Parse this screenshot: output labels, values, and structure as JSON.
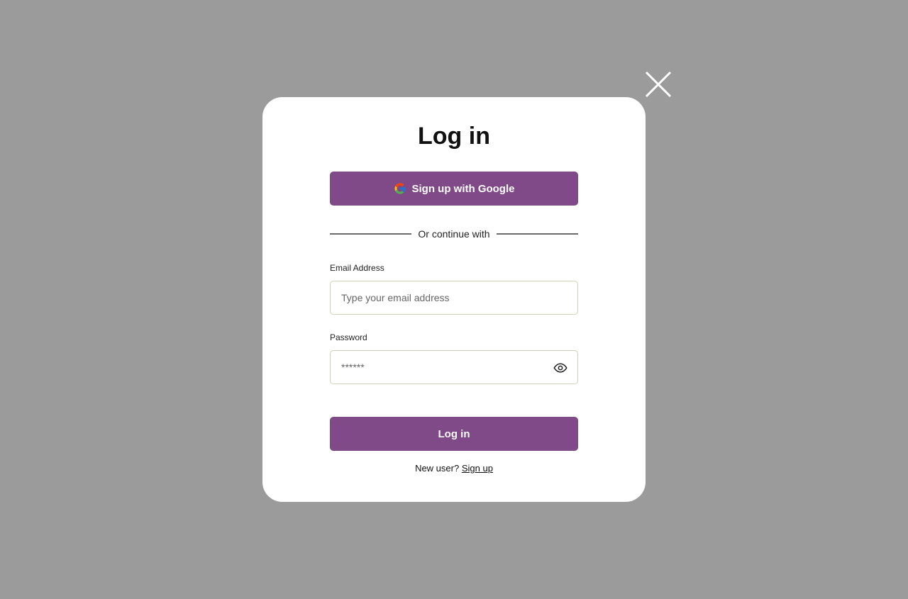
{
  "modal": {
    "title": "Log in",
    "google_button_label": "Sign up with Google",
    "divider_text": "Or continue with",
    "email": {
      "label": "Email Address",
      "placeholder": "Type your email address",
      "value": ""
    },
    "password": {
      "label": "Password",
      "placeholder": "******",
      "value": ""
    },
    "login_button_label": "Log in",
    "footer": {
      "prompt": "New user?",
      "link_label": "Sign up"
    }
  },
  "icons": {
    "close": "close-icon",
    "google": "google-icon",
    "eye": "eye-icon"
  },
  "colors": {
    "backdrop": "#9b9b9b",
    "modal_bg": "#ffffff",
    "accent": "#804a89",
    "input_border": "#cfd1b8"
  }
}
